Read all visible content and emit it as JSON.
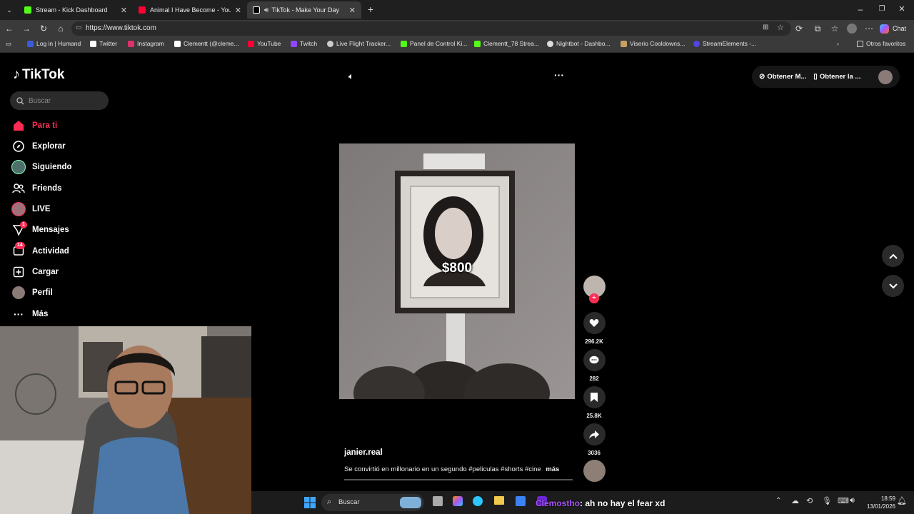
{
  "browser": {
    "tabs": [
      {
        "label": "Stream - Kick Dashboard",
        "color": "#53fc18"
      },
      {
        "label": "Animal I Have Become - YouTube",
        "color": "#ff0033"
      },
      {
        "label": "TikTok - Make Your Day",
        "color": "#ffffff"
      }
    ],
    "url": "https://www.tiktok.com",
    "chat_label": "Chat",
    "bookmarks": [
      {
        "label": "Log in | Humand",
        "color": "#3b5bdb"
      },
      {
        "label": "Twitter",
        "color": "#ffffff"
      },
      {
        "label": "Instagram",
        "color": "#e1306c"
      },
      {
        "label": "Clementt (@cleme...",
        "color": "#ffffff"
      },
      {
        "label": "YouTube",
        "color": "#ff0033"
      },
      {
        "label": "Twitch",
        "color": "#9146ff"
      },
      {
        "label": "Live Flight Tracker...",
        "color": "#cccccc"
      },
      {
        "label": "Panel de Control Ki...",
        "color": "#53fc18"
      },
      {
        "label": "Clementt_78 Strea...",
        "color": "#53fc18"
      },
      {
        "label": "Nightbot - Dashbo...",
        "color": "#dddddd"
      },
      {
        "label": "Viserio Cooldowns...",
        "color": "#c8a060"
      },
      {
        "label": "StreamElements -...",
        "color": "#4f46e5"
      }
    ],
    "other_bookmarks": "Otros favoritos"
  },
  "tiktok": {
    "logo": "TikTok",
    "search_placeholder": "Buscar",
    "nav": [
      {
        "label": "Para ti",
        "icon": "home-icon"
      },
      {
        "label": "Explorar",
        "icon": "compass-icon"
      },
      {
        "label": "Siguiendo",
        "icon": "following-avatar-icon"
      },
      {
        "label": "Friends",
        "icon": "friends-icon"
      },
      {
        "label": "LIVE",
        "icon": "live-avatar-icon"
      },
      {
        "label": "Mensajes",
        "icon": "messages-icon",
        "badge": "1"
      },
      {
        "label": "Actividad",
        "icon": "activity-icon",
        "badge": "14"
      },
      {
        "label": "Cargar",
        "icon": "upload-icon"
      },
      {
        "label": "Perfil",
        "icon": "profile-avatar-icon"
      },
      {
        "label": "Más",
        "icon": "more-icon"
      }
    ],
    "top_right": {
      "coins": "Obtener M...",
      "app": "Obtener la ..."
    },
    "video": {
      "overlay_price": "$800",
      "author": "janier.real",
      "caption": "Se convirtió en millonario en un segundo #peliculas #shorts #cine",
      "more": "más"
    },
    "actions": {
      "likes": "296.2K",
      "comments": "282",
      "saves": "25.8K",
      "shares": "3036"
    }
  },
  "taskbar": {
    "search_placeholder": "Buscar",
    "chat_overlay_user": "Clemostho",
    "chat_overlay_text": "ah no hay el fear xd",
    "time": "18:59",
    "date": "13/01/2026"
  },
  "colors": {
    "accent": "#fe2c55",
    "background": "#000000",
    "chrome": "#3a3a3a"
  }
}
